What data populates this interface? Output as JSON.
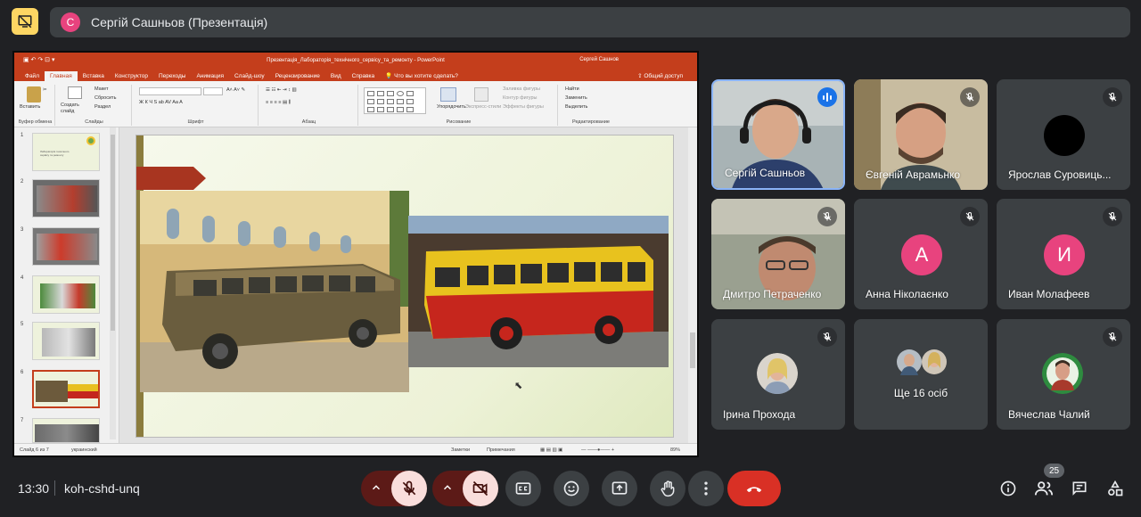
{
  "top_bar": {
    "presenter_initial": "С",
    "presenter_title": "Сергій Сашньов (Презентація)"
  },
  "powerpoint": {
    "window_title": "Презентація_Лабораторія_технічного_сервісу_та_ремонту - PowerPoint",
    "user": "Сергей Сашнов",
    "tabs": [
      "Файл",
      "Главная",
      "Вставка",
      "Конструктор",
      "Переходы",
      "Анимация",
      "Слайд-шоу",
      "Рецензирование",
      "Вид",
      "Справка"
    ],
    "active_tab": "Главная",
    "tell_me": "Что вы хотите сделать?",
    "share": "Общий доступ",
    "ribbon": {
      "paste": "Вставить",
      "create_slide": "Создать слайд",
      "layout": "Макет",
      "reset": "Сбросить",
      "section": "Раздел",
      "arrange": "Упорядочить",
      "quick_styles": "Экспресс-стили",
      "shape_fill": "Заливка фигуры",
      "shape_outline": "Контур фигуры",
      "shape_effects": "Эффекты фигуры",
      "find": "Найти",
      "replace": "Заменить",
      "select": "Выделить",
      "groups": [
        "Буфер обмена",
        "Слайды",
        "Шрифт",
        "Абзац",
        "Рисование",
        "Редактирование"
      ]
    },
    "thumbnails": [
      "1",
      "2",
      "3",
      "4",
      "5",
      "6",
      "7"
    ],
    "thumb1_text": "Лабораторія технічного сервісу та ремонту",
    "selected_slide": 6,
    "status": {
      "slide": "Слайд 6 из 7",
      "language": "украинский",
      "notes": "Заметки",
      "comments": "Примечания",
      "zoom": "89%"
    }
  },
  "participants": [
    {
      "name": "Сергій Сашньов",
      "speaking": true,
      "type": "video"
    },
    {
      "name": "Євгеній Аврамьнко",
      "muted": true,
      "type": "video"
    },
    {
      "name": "Ярослав Суровиць...",
      "muted": true,
      "type": "avatar",
      "avatar_color": "#000000",
      "initial": ""
    },
    {
      "name": "Дмитро Петраченко",
      "muted": true,
      "type": "video"
    },
    {
      "name": "Анна Ніколаєнко",
      "muted": true,
      "type": "avatar",
      "avatar_color": "#e8437e",
      "initial": "А"
    },
    {
      "name": "Иван Молафеев",
      "muted": true,
      "type": "avatar",
      "avatar_color": "#e8437e",
      "initial": "И"
    },
    {
      "name": "Ірина Прохода",
      "muted": true,
      "type": "photo"
    },
    {
      "name": "Ще 16 осіб",
      "type": "more"
    },
    {
      "name": "Вячеслав Чалий",
      "muted": true,
      "type": "photo"
    }
  ],
  "bottom_bar": {
    "time": "13:30",
    "meeting_code": "koh-cshd-unq",
    "participants_count": "25",
    "colors": {
      "hangup": "#d93025",
      "muted_bg": "#f9dedc"
    }
  },
  "icons": [
    "present-off-icon",
    "mic-off-icon",
    "camera-off-icon",
    "captions-icon",
    "emoji-icon",
    "present-icon",
    "hand-icon",
    "more-vert-icon",
    "hangup-icon",
    "info-icon",
    "people-icon",
    "chat-icon",
    "activities-icon"
  ]
}
